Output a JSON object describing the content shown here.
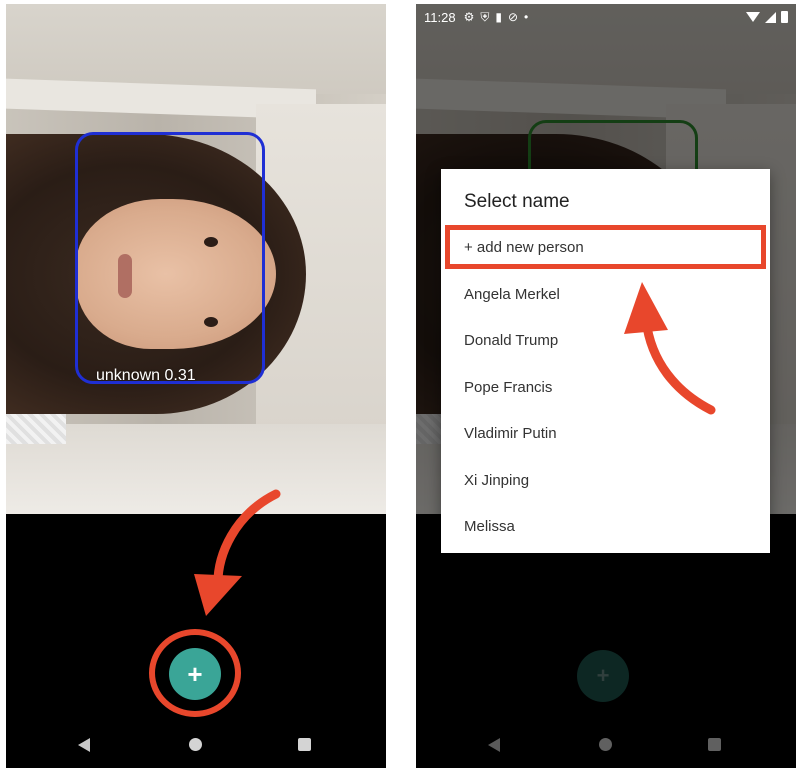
{
  "left_screen": {
    "face_label": "unknown 0.31",
    "fab_label": "+"
  },
  "right_screen": {
    "status_bar": {
      "time": "11:28",
      "left_icons": [
        "gear-icon",
        "shield-icon",
        "sd-card-icon",
        "sync-icon",
        "dot-icon"
      ],
      "right_icons": [
        "wifi-icon",
        "cell-signal-icon",
        "battery-icon"
      ]
    },
    "dialog": {
      "title": "Select name",
      "items": [
        "+ add new person",
        "Angela Merkel",
        "Donald Trump",
        "Pope Francis",
        "Vladimir Putin",
        "Xi Jinping",
        "Melissa"
      ]
    },
    "fab_label": "+"
  },
  "colors": {
    "face_box_left": "#1f2fd4",
    "face_box_right": "#2e8b2e",
    "fab": "#3aa597",
    "annotation": "#e8472c"
  }
}
